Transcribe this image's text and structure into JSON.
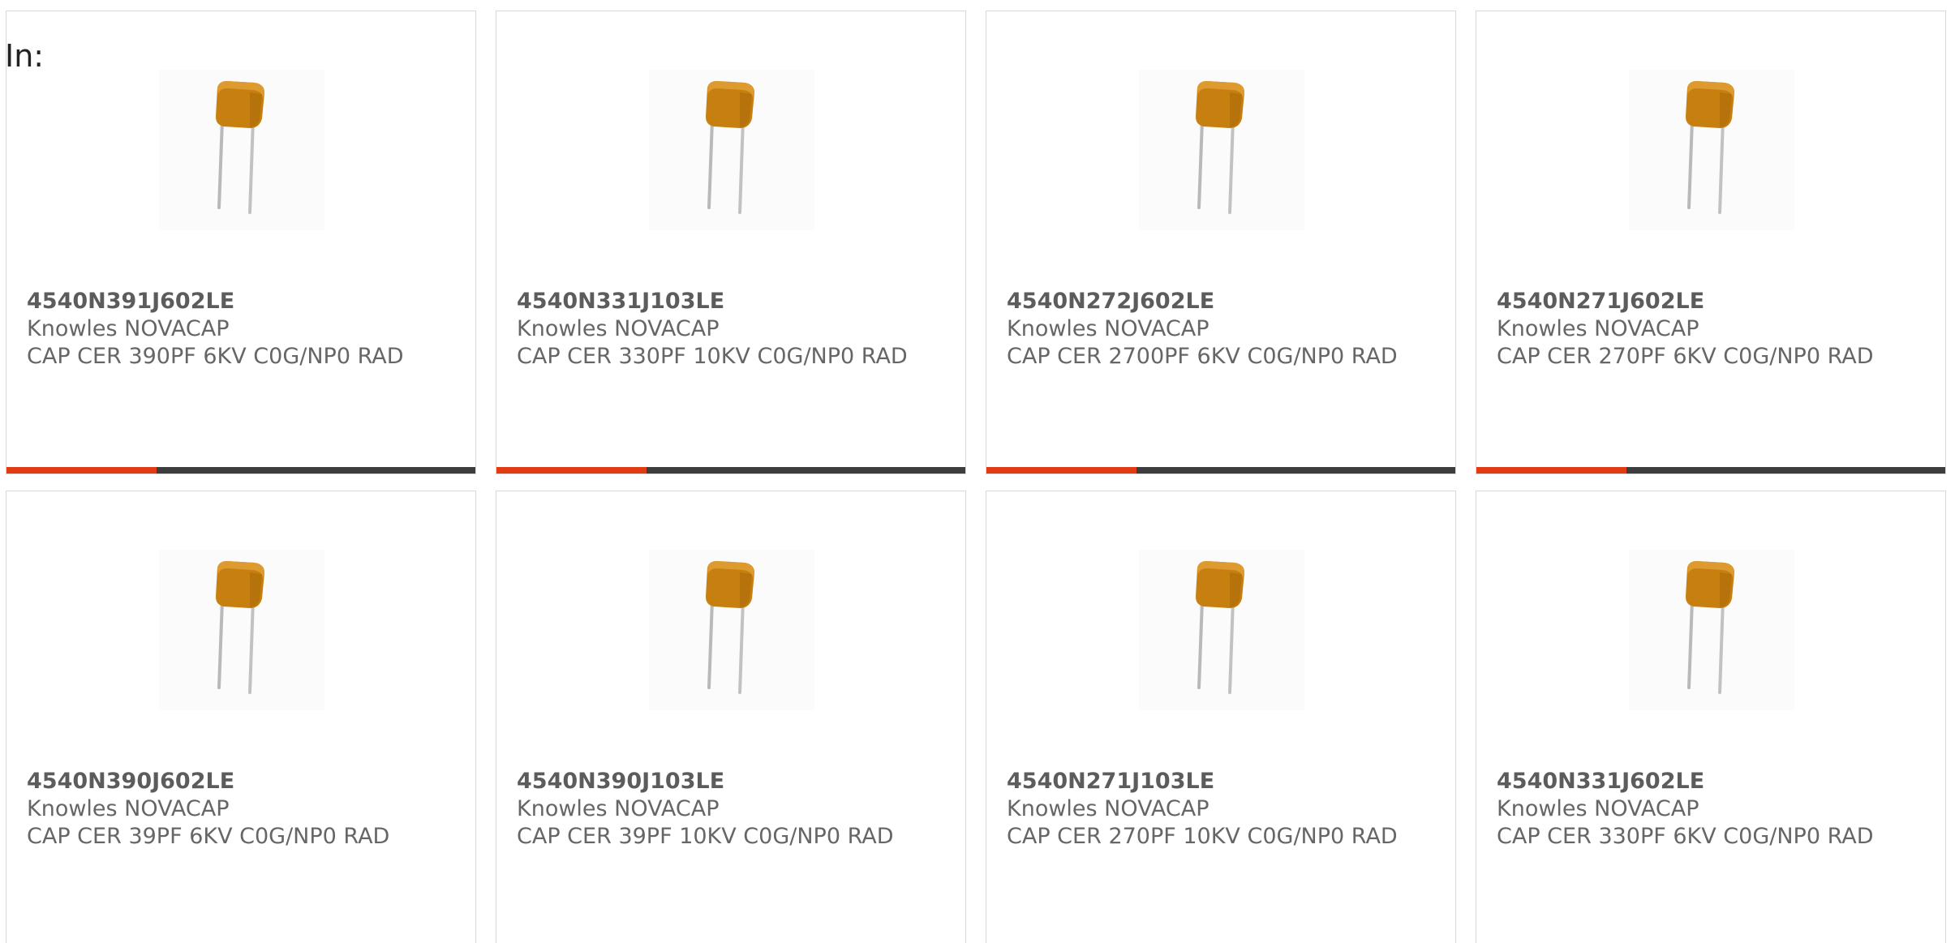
{
  "filter_label": "In:",
  "colors": {
    "progress_accent": "#e03b12",
    "progress_track": "#3d3d3d",
    "capacitor_body": "#c77f0f"
  },
  "products": [
    {
      "part_number": "4540N391J602LE",
      "manufacturer": "Knowles NOVACAP",
      "description": "CAP CER 390PF 6KV C0G/NP0 RAD",
      "image_icon": "radial-capacitor-image",
      "progress": 0.32
    },
    {
      "part_number": "4540N331J103LE",
      "manufacturer": "Knowles NOVACAP",
      "description": "CAP CER 330PF 10KV C0G/NP0 RAD",
      "image_icon": "radial-capacitor-image",
      "progress": 0.32
    },
    {
      "part_number": "4540N272J602LE",
      "manufacturer": "Knowles NOVACAP",
      "description": "CAP CER 2700PF 6KV C0G/NP0 RAD",
      "image_icon": "radial-capacitor-image",
      "progress": 0.32
    },
    {
      "part_number": "4540N271J602LE",
      "manufacturer": "Knowles NOVACAP",
      "description": "CAP CER 270PF 6KV C0G/NP0 RAD",
      "image_icon": "radial-capacitor-image",
      "progress": 0.32
    },
    {
      "part_number": "4540N390J602LE",
      "manufacturer": "Knowles NOVACAP",
      "description": "CAP CER 39PF 6KV C0G/NP0 RAD",
      "image_icon": "radial-capacitor-image"
    },
    {
      "part_number": "4540N390J103LE",
      "manufacturer": "Knowles NOVACAP",
      "description": "CAP CER 39PF 10KV C0G/NP0 RAD",
      "image_icon": "radial-capacitor-image"
    },
    {
      "part_number": "4540N271J103LE",
      "manufacturer": "Knowles NOVACAP",
      "description": "CAP CER 270PF 10KV C0G/NP0 RAD",
      "image_icon": "radial-capacitor-image"
    },
    {
      "part_number": "4540N331J602LE",
      "manufacturer": "Knowles NOVACAP",
      "description": "CAP CER 330PF 6KV C0G/NP0 RAD",
      "image_icon": "radial-capacitor-image"
    }
  ]
}
